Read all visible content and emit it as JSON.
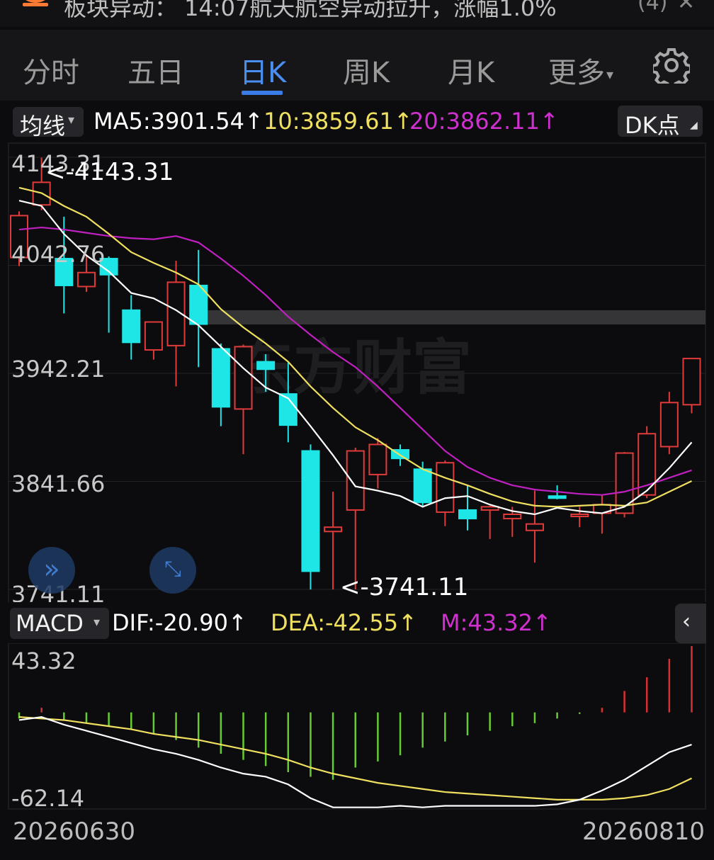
{
  "notice": {
    "text": "板块异动： 14:07航天航空异动拉升，涨幅1.0%",
    "count": "(4)"
  },
  "tabs": [
    {
      "label": "分时",
      "active": false
    },
    {
      "label": "五日",
      "active": false
    },
    {
      "label": "日K",
      "active": true
    },
    {
      "label": "周K",
      "active": false
    },
    {
      "label": "月K",
      "active": false
    },
    {
      "label": "更多",
      "active": false
    }
  ],
  "ma_row": {
    "selector": "均线",
    "ma5": "MA5:3901.54↑",
    "ma10": "10:3859.61↑",
    "ma20": "20:3862.11↑",
    "dk_button": "DK点"
  },
  "price_chart": {
    "y_labels": [
      "4143.31",
      "4042.76",
      "3942.21",
      "3841.66",
      "3741.11"
    ],
    "high_marker": "<-4143.31",
    "low_marker": "<-3741.11",
    "watermark": "东方财富"
  },
  "macd_row": {
    "selector": "MACD",
    "dif": "DIF:-20.90↑",
    "dea": "DEA:-42.55↑",
    "m": "M:43.32↑"
  },
  "macd_chart": {
    "y_max_label": "43.32",
    "y_min_label": "-62.14"
  },
  "date_axis": {
    "start": "20260630",
    "end": "20260810"
  },
  "colors": {
    "up": "#e03a3a",
    "down": "#1ee6e6",
    "ma5": "#ffffff",
    "ma10": "#f0e060",
    "ma20": "#c020c0",
    "macd_pos": "#d83030",
    "macd_neg": "#66cc33",
    "accent": "#3b7de8"
  },
  "chart_data": [
    {
      "type": "candlestick",
      "title": "",
      "ylim": [
        3741.11,
        4143.31
      ],
      "y_ticks": [
        4143.31,
        4042.76,
        3942.21,
        3841.66,
        3741.11
      ],
      "x_range": [
        "20260630",
        "20260810"
      ],
      "candles": [
        {
          "o": 4050,
          "h": 4093,
          "l": 4042,
          "c": 4089
        },
        {
          "o": 4099,
          "h": 4143,
          "l": 4094,
          "c": 4120
        },
        {
          "o": 4049,
          "h": 4088,
          "l": 3998,
          "c": 4024
        },
        {
          "o": 4023,
          "h": 4053,
          "l": 4018,
          "c": 4036
        },
        {
          "o": 4049,
          "h": 4051,
          "l": 3980,
          "c": 4034
        },
        {
          "o": 4001,
          "h": 4015,
          "l": 3955,
          "c": 3971
        },
        {
          "o": 3964,
          "h": 3978,
          "l": 3955,
          "c": 3990
        },
        {
          "o": 3968,
          "h": 4047,
          "l": 3930,
          "c": 4027
        },
        {
          "o": 4024,
          "h": 4057,
          "l": 3948,
          "c": 3988
        },
        {
          "o": 3965,
          "h": 3970,
          "l": 3893,
          "c": 3911
        },
        {
          "o": 3909,
          "h": 3969,
          "l": 3867,
          "c": 3967
        },
        {
          "o": 3953,
          "h": 3960,
          "l": 3925,
          "c": 3946
        },
        {
          "o": 3923,
          "h": 3952,
          "l": 3878,
          "c": 3894
        },
        {
          "o": 3870,
          "h": 3876,
          "l": 3741,
          "c": 3758
        },
        {
          "o": 3795,
          "h": 3832,
          "l": 3741,
          "c": 3799
        },
        {
          "o": 3815,
          "h": 3873,
          "l": 3741,
          "c": 3870
        },
        {
          "o": 3848,
          "h": 3882,
          "l": 3835,
          "c": 3876
        },
        {
          "o": 3871,
          "h": 3876,
          "l": 3856,
          "c": 3863
        },
        {
          "o": 3853,
          "h": 3860,
          "l": 3818,
          "c": 3822
        },
        {
          "o": 3813,
          "h": 3861,
          "l": 3800,
          "c": 3859
        },
        {
          "o": 3815,
          "h": 3838,
          "l": 3796,
          "c": 3807
        },
        {
          "o": 3815,
          "h": 3819,
          "l": 3788,
          "c": 3818
        },
        {
          "o": 3807,
          "h": 3818,
          "l": 3790,
          "c": 3811
        },
        {
          "o": 3796,
          "h": 3833,
          "l": 3766,
          "c": 3802
        },
        {
          "o": 3828,
          "h": 3838,
          "l": 3825,
          "c": 3826
        },
        {
          "o": 3809,
          "h": 3818,
          "l": 3799,
          "c": 3811
        },
        {
          "o": 3812,
          "h": 3829,
          "l": 3793,
          "c": 3820
        },
        {
          "o": 3812,
          "h": 3869,
          "l": 3808,
          "c": 3868
        },
        {
          "o": 3829,
          "h": 3893,
          "l": 3826,
          "c": 3886
        },
        {
          "o": 3874,
          "h": 3925,
          "l": 3867,
          "c": 3915
        },
        {
          "o": 3913,
          "h": 3917,
          "l": 3905,
          "c": 3956
        }
      ],
      "ma5": [
        4103,
        4098,
        4072,
        4052,
        4037,
        4017,
        4012,
        4001,
        3987,
        3967,
        3947,
        3929,
        3919,
        3893,
        3866,
        3837,
        3833,
        3828,
        3818,
        3826,
        3828,
        3820,
        3814,
        3811,
        3817,
        3814,
        3812,
        3818,
        3833,
        3854,
        3878
      ],
      "ma10": [
        4115,
        4110,
        4098,
        4088,
        4072,
        4055,
        4045,
        4036,
        4025,
        4002,
        3985,
        3970,
        3953,
        3930,
        3910,
        3892,
        3880,
        3866,
        3853,
        3845,
        3838,
        3830,
        3823,
        3819,
        3818,
        3819,
        3820,
        3819,
        3822,
        3832,
        3842
      ],
      "ma20": [
        4076,
        4078,
        4076,
        4073,
        4070,
        4068,
        4067,
        4070,
        4064,
        4049,
        4033,
        4015,
        3995,
        3978,
        3962,
        3948,
        3930,
        3910,
        3890,
        3870,
        3855,
        3845,
        3838,
        3834,
        3832,
        3830,
        3829,
        3832,
        3838,
        3845,
        3852
      ]
    },
    {
      "type": "bar",
      "title": "MACD",
      "ylim": [
        -62.14,
        43.32
      ],
      "dif": [
        -5,
        -3,
        -8,
        -12,
        -16,
        -20,
        -24,
        -27,
        -31,
        -36,
        -40,
        -42,
        -47,
        -56,
        -62,
        -62,
        -62,
        -61,
        -62,
        -61,
        -61,
        -61,
        -61,
        -61,
        -60,
        -57,
        -51,
        -44,
        -35,
        -26,
        -21
      ],
      "dea": [
        -3,
        -4,
        -5,
        -7,
        -9,
        -11,
        -14,
        -16,
        -18,
        -21,
        -24,
        -27,
        -31,
        -36,
        -40,
        -43,
        -46,
        -48,
        -50,
        -52,
        -53,
        -54,
        -55,
        -56,
        -57,
        -57,
        -57,
        -56,
        -54,
        -50,
        -43
      ],
      "m": [
        -4,
        3,
        -5,
        -7,
        -9,
        -11,
        -14,
        -18,
        -23,
        -27,
        -31,
        -35,
        -39,
        -42,
        -44,
        -36,
        -32,
        -28,
        -23,
        -19,
        -15,
        -12,
        -9,
        -7,
        -4,
        -1,
        3,
        14,
        23,
        35,
        43.32
      ]
    }
  ]
}
